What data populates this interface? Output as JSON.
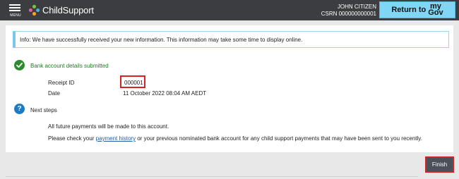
{
  "header": {
    "menu_label": "MENU",
    "app_name": "ChildSupport",
    "user_name": "JOHN CITIZEN",
    "csrn": "CSRN 000000000001",
    "return_label": "Return to",
    "return_brand_top": "my",
    "return_brand_bottom": "Gov"
  },
  "info_banner": "Info: We have successfully received your new information. This information may take some time to display online.",
  "confirmation": {
    "title": "Bank account details submitted",
    "receipt_label": "Receipt ID",
    "receipt_value": "000001",
    "date_label": "Date",
    "date_value": "11 October 2022 08:04 AM AEDT"
  },
  "next_steps": {
    "title": "Next steps",
    "line1": "All future payments will be made to this account.",
    "line2_before": "Please check your ",
    "line2_link": "payment history",
    "line2_after": " or your previous nominated bank account for any child support payments that may have been sent to you recently."
  },
  "actions": {
    "finish_label": "Finish"
  },
  "colors": {
    "topbar": "#3b3d40",
    "mygov_button": "#7fd6f5",
    "success": "#2e8a2e",
    "info_icon": "#1f7ac4",
    "highlight": "#d42323"
  },
  "icons": {
    "menu": "hamburger-icon",
    "logo": "childsupport-logo-icon",
    "success": "check-circle-icon",
    "next_steps": "question-circle-icon"
  }
}
